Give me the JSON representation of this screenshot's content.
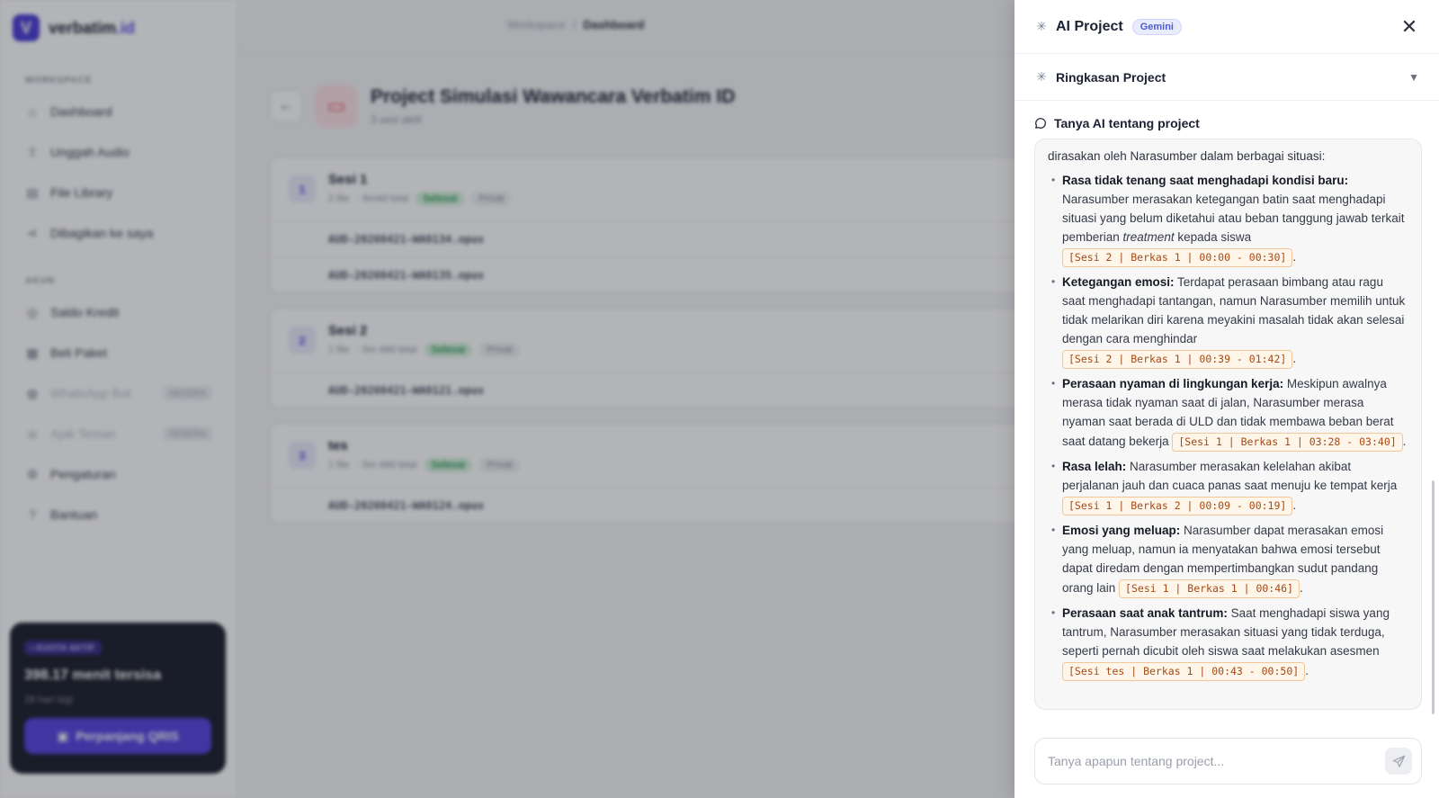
{
  "app": {
    "brand": {
      "name_main": "verbatim",
      "name_accent": ".id",
      "logo_letter": "V"
    },
    "sidebar": {
      "section_workspace": "WORKSPACE",
      "workspace_items": [
        {
          "label": "Dashboard",
          "icon": "home-icon"
        },
        {
          "label": "Unggah Audio",
          "icon": "upload-icon"
        },
        {
          "label": "File Library",
          "icon": "file-icon"
        },
        {
          "label": "Dibagikan ke saya",
          "icon": "share-icon"
        }
      ],
      "section_account": "AKUN",
      "account_items": [
        {
          "label": "Saldo Kredit",
          "icon": "coin-icon"
        },
        {
          "label": "Beli Paket",
          "icon": "receipt-icon"
        },
        {
          "label": "WhatsApp Bot",
          "icon": "whatsapp-icon",
          "badge": "SEGERA"
        },
        {
          "label": "Ajak Teman",
          "icon": "users-icon",
          "badge": "SEGERA"
        },
        {
          "label": "Pengaturan",
          "icon": "gear-icon"
        },
        {
          "label": "Bantuan",
          "icon": "help-icon"
        }
      ],
      "quota": {
        "badge": "• KUOTA AKTIF",
        "remaining": "398.17 menit tersisa",
        "days_left": "28 hari lagi",
        "button": "Perpanjang QRIS"
      }
    },
    "breadcrumb": {
      "root": "Workspace",
      "sep": "/",
      "current": "Dashboard"
    },
    "project": {
      "title": "Project Simulasi Wawancara Verbatim ID",
      "subtitle": "3 sesi aktif",
      "sessions": [
        {
          "num": "1",
          "name": "Sesi 1",
          "files_count": "2 file",
          "duration": "· 9m4d total",
          "status": "Selesai",
          "privacy": "Privat",
          "files": [
            "AUD-20260421-WA0134.opus",
            "AUD-20260421-WA0135.opus"
          ]
        },
        {
          "num": "2",
          "name": "Sesi 2",
          "files_count": "1 file",
          "duration": "· 5m 48d total",
          "status": "Selesai",
          "privacy": "Privat",
          "files": [
            "AUD-20260421-WA0121.opus"
          ]
        },
        {
          "num": "3",
          "name": "tes",
          "files_count": "1 file",
          "duration": "· 5m 48d total",
          "status": "Selesai",
          "privacy": "Privat",
          "files": [
            "AUD-20260421-WA0124.opus"
          ]
        }
      ]
    }
  },
  "panel": {
    "title": "AI Project",
    "model_badge": "Gemini",
    "close_glyph": "✕",
    "summary_label": "Ringkasan Project",
    "summary_caret": "▼",
    "ask_label": "Tanya AI tentang project",
    "answer_intro": "dirasakan oleh Narasumber dalam berbagai situasi:",
    "answer_items": [
      {
        "title": "Rasa tidak tenang saat menghadapi kondisi baru:",
        "body": " Narasumber merasakan ketegangan batin saat menghadapi situasi yang belum diketahui atau beban tanggung jawab terkait pemberian ",
        "em": "treatment",
        "body_after": " kepada siswa ",
        "cite": "[Sesi 2 | Berkas 1 | 00:00 - 00:30]"
      },
      {
        "title": "Ketegangan emosi:",
        "body": " Terdapat perasaan bimbang atau ragu saat menghadapi tantangan, namun Narasumber memilih untuk tidak melarikan diri karena meyakini masalah tidak akan selesai dengan cara menghindar ",
        "em": "",
        "body_after": "",
        "cite": "[Sesi 2 | Berkas 1 | 00:39 - 01:42]"
      },
      {
        "title": "Perasaan nyaman di lingkungan kerja:",
        "body": " Meskipun awalnya merasa tidak nyaman saat di jalan, Narasumber merasa nyaman saat berada di ULD dan tidak membawa beban berat saat datang bekerja ",
        "em": "",
        "body_after": "",
        "cite": "[Sesi 1 | Berkas 1 | 03:28 - 03:40]"
      },
      {
        "title": "Rasa lelah:",
        "body": " Narasumber merasakan kelelahan akibat perjalanan jauh dan cuaca panas saat menuju ke tempat kerja ",
        "em": "",
        "body_after": "",
        "cite": "[Sesi 1 | Berkas 2 | 00:09 - 00:19]"
      },
      {
        "title": "Emosi yang meluap:",
        "body": " Narasumber dapat merasakan emosi yang meluap, namun ia menyatakan bahwa emosi tersebut dapat diredam dengan mempertimbangkan sudut pandang orang lain ",
        "em": "",
        "body_after": "",
        "cite": "[Sesi 1 | Berkas 1 | 00:46]"
      },
      {
        "title": "Perasaan saat anak tantrum:",
        "body": " Saat menghadapi siswa yang tantrum, Narasumber merasakan situasi yang tidak terduga, seperti pernah dicubit oleh siswa saat melakukan asesmen ",
        "em": "",
        "body_after": "",
        "cite": "[Sesi tes | Berkas 1 | 00:43 - 00:50]"
      }
    ],
    "input_placeholder": "Tanya apapun tentang project...",
    "input_value": ""
  }
}
